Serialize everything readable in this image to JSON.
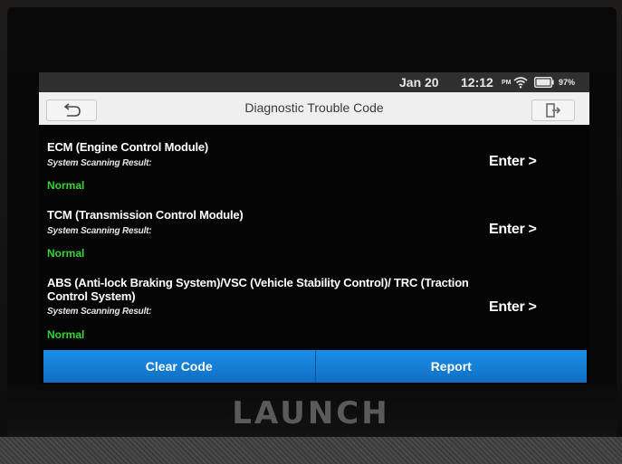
{
  "brand": "LAUNCH",
  "statusbar": {
    "date": "Jan 20",
    "time": "12:12",
    "ampm": "PM",
    "battery": "97%",
    "icons": [
      "wifi-icon",
      "battery-icon"
    ]
  },
  "titlebar": {
    "title": "Diagnostic Trouble Code",
    "back_icon": "back-arrow-icon",
    "exit_icon": "exit-icon"
  },
  "systems": [
    {
      "name": "ECM (Engine Control Module)",
      "result_label": "System Scanning Result:",
      "status": "Normal",
      "enter_label": "Enter >"
    },
    {
      "name": "TCM (Transmission Control Module)",
      "result_label": "System Scanning Result:",
      "status": "Normal",
      "enter_label": "Enter >"
    },
    {
      "name": "ABS (Anti-lock Braking System)/VSC (Vehicle Stability Control)/ TRC (Traction Control System)",
      "result_label": "System Scanning Result:",
      "status": "Normal",
      "enter_label": "Enter >"
    }
  ],
  "actions": {
    "clear_code": "Clear Code",
    "report": "Report"
  },
  "colors": {
    "accent_blue": "#1a8fe6",
    "status_normal": "#33d433",
    "screen_bg": "#050505",
    "titlebar_bg": "#efefef"
  }
}
